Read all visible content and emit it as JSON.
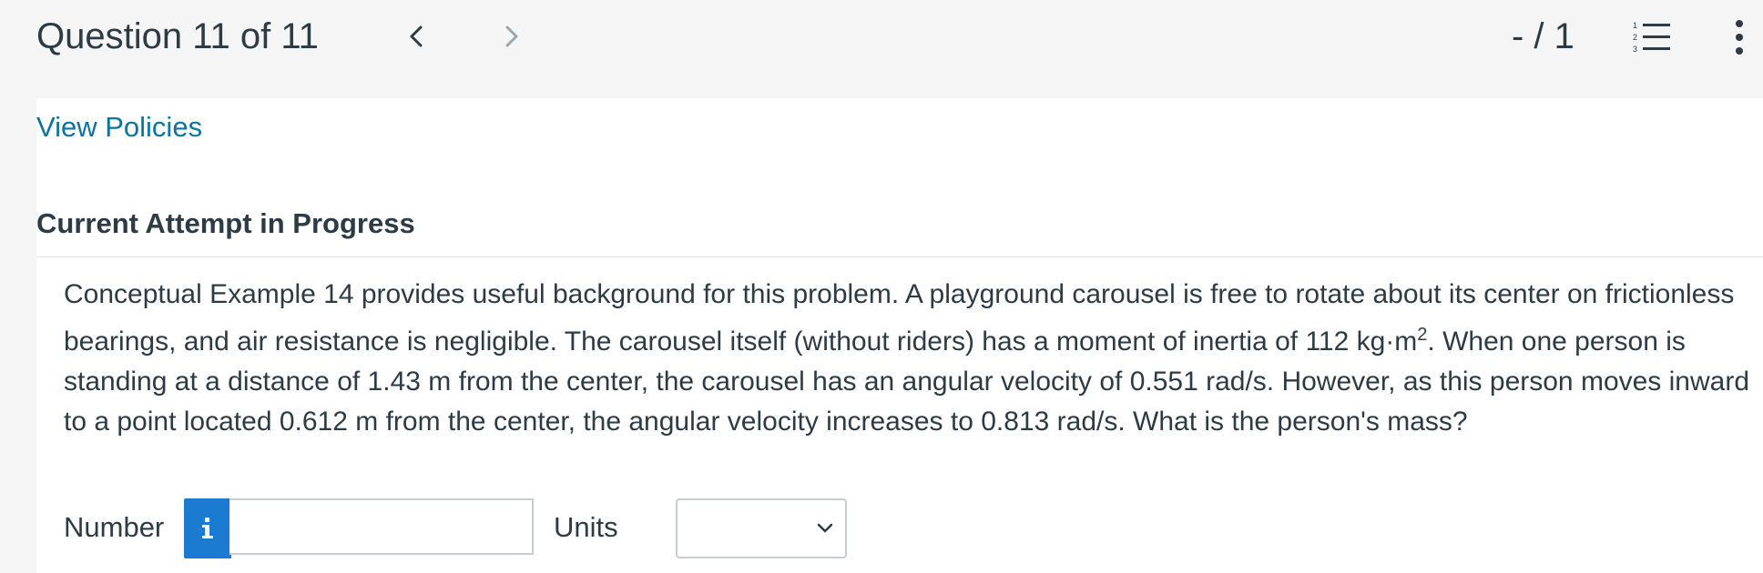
{
  "header": {
    "question_label": "Question 11 of 11",
    "score": "- / 1"
  },
  "icons": {
    "prev": "chevron-left-icon",
    "next": "chevron-right-icon",
    "question_list": "numbered-list-icon",
    "more": "kebab-menu-icon",
    "info": "info-icon",
    "select": "chevron-down-icon"
  },
  "links": {
    "view_policies": "View Policies"
  },
  "attempt_heading": "Current Attempt in Progress",
  "question": {
    "text_before_sup": "Conceptual Example 14 provides useful background for this problem. A playground carousel is free to rotate about its center on frictionless bearings, and air resistance is negligible. The carousel itself (without riders) has a moment of inertia of 112 kg·m",
    "sup": "2",
    "text_after_sup": ". When one person is standing at a distance of 1.43 m from the center, the carousel has an angular velocity of 0.551 rad/s. However, as this person moves inward to a point located 0.612 m from the center, the angular velocity increases to 0.813 rad/s. What is the person's mass?"
  },
  "answer": {
    "number_label": "Number",
    "number_value": "",
    "units_label": "Units",
    "units_selected": ""
  },
  "colors": {
    "link": "#0b74a4",
    "info_button": "#1a7bd1",
    "text": "#2d3b45",
    "header_bg": "#f5f5f5"
  }
}
